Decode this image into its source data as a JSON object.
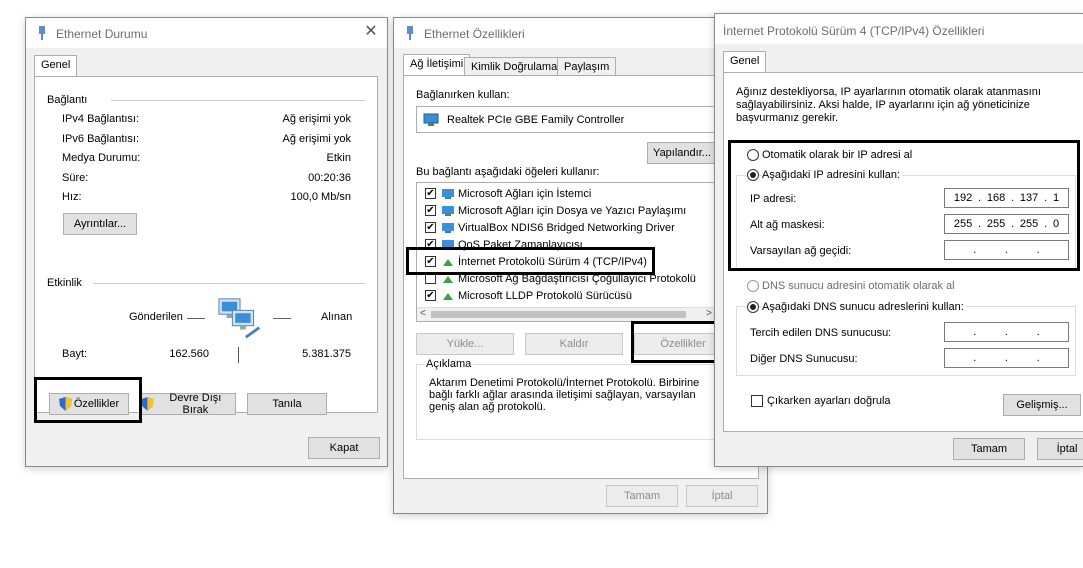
{
  "w1": {
    "title": "Ethernet Durumu",
    "tab": "Genel",
    "connection_section": "Bağlantı",
    "rows": [
      {
        "label": "IPv4 Bağlantısı:",
        "value": "Ağ erişimi yok"
      },
      {
        "label": "IPv6 Bağlantısı:",
        "value": "Ağ erişimi yok"
      },
      {
        "label": "Medya Durumu:",
        "value": "Etkin"
      },
      {
        "label": "Süre:",
        "value": "00:20:36"
      },
      {
        "label": "Hız:",
        "value": "100,0 Mb/sn"
      }
    ],
    "details_button": "Ayrıntılar...",
    "activity_section": "Etkinlik",
    "sent_label": "Gönderilen",
    "received_label": "Alınan",
    "bytes_label": "Bayt:",
    "bytes_sent": "162.560",
    "bytes_received": "5.381.375",
    "properties_button": "Özellikler",
    "disable_button": "Devre Dışı Bırak",
    "diagnose_button": "Tanıla",
    "close_button": "Kapat"
  },
  "w2": {
    "title": "Ethernet Özellikleri",
    "tabs": [
      "Ağ İletişimi",
      "Kimlik Doğrulama",
      "Paylaşım"
    ],
    "connect_using_label": "Bağlanırken kullan:",
    "adapter_name": "Realtek PCIe GBE Family Controller",
    "configure_button": "Yapılandır...",
    "items_label": "Bu bağlantı aşağıdaki öğeleri kullanır:",
    "items": [
      {
        "label": "Microsoft Ağları için İstemci",
        "checked": true
      },
      {
        "label": "Microsoft Ağları için Dosya ve Yazıcı Paylaşımı",
        "checked": true
      },
      {
        "label": "VirtualBox NDIS6 Bridged Networking Driver",
        "checked": true
      },
      {
        "label": "QoS Paket Zamanlayıcısı",
        "checked": true
      },
      {
        "label": "İnternet Protokolü Sürüm 4 (TCP/IPv4)",
        "checked": true
      },
      {
        "label": "Microsoft Ağ Bağdaştırıcısı Çoğullayıcı Protokolü",
        "checked": false
      },
      {
        "label": "Microsoft LLDP Protokolü Sürücüsü",
        "checked": true
      }
    ],
    "install_button": "Yükle...",
    "uninstall_button": "Kaldır",
    "properties_button": "Özellikler",
    "description_label": "Açıklama",
    "description_text": "Aktarım Denetimi Protokolü/İnternet Protokolü. Birbirine bağlı farklı ağlar arasında iletişimi sağlayan, varsayılan geniş alan ağ protokolü.",
    "ok_button": "Tamam",
    "cancel_button": "İptal"
  },
  "w3": {
    "title": "İnternet Protokolü Sürüm 4 (TCP/IPv4) Özellikleri",
    "tab": "Genel",
    "intro": "Ağınız destekliyorsa, IP ayarlarının otomatik olarak atanmasını sağlayabilirsiniz. Aksi halde, IP ayarlarını için ağ yöneticinize başvurmanız gerekir.",
    "auto_ip_radio": "Otomatik olarak bir IP adresi al",
    "manual_ip_radio": "Aşağıdaki IP adresini kullan:",
    "ip_label": "IP adresi:",
    "ip_value": [
      "192",
      "168",
      "137",
      "1"
    ],
    "mask_label": "Alt ağ maskesi:",
    "mask_value": [
      "255",
      "255",
      "255",
      "0"
    ],
    "gateway_label": "Varsayılan ağ geçidi:",
    "auto_dns_radio": "DNS sunucu adresini otomatik olarak al",
    "manual_dns_radio": "Aşağıdaki DNS sunucu adreslerini kullan:",
    "preferred_dns_label": "Tercih edilen DNS sunucusu:",
    "alternate_dns_label": "Diğer DNS Sunucusu:",
    "validate_checkbox": "Çıkarken ayarları doğrula",
    "advanced_button": "Gelişmiş...",
    "ok_button": "Tamam",
    "cancel_button": "İptal"
  }
}
